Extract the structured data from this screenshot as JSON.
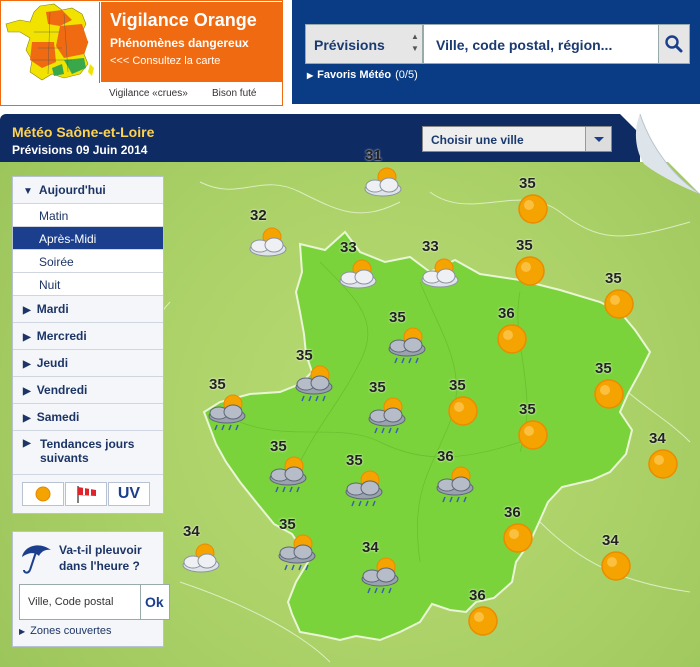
{
  "vigilance": {
    "title": "Vigilance Orange",
    "subtitle": "Phénomènes dangereux",
    "link": "<<< Consultez la carte",
    "crues": "Vigilance «crues»",
    "bison": "Bison futé"
  },
  "search": {
    "category": "Prévisions",
    "placeholder": "Ville, code postal, région...",
    "favorites_label": "Favoris Météo",
    "favorites_count": "(0/5)"
  },
  "header": {
    "title": "Météo Saône-et-Loire",
    "date": "Prévisions 09 Juin 2014",
    "city_select": "Choisir une ville"
  },
  "days": [
    {
      "label": "Aujourd'hui",
      "open": true
    },
    {
      "label": "Mardi"
    },
    {
      "label": "Mercredi"
    },
    {
      "label": "Jeudi"
    },
    {
      "label": "Vendredi"
    },
    {
      "label": "Samedi"
    },
    {
      "label": "Tendances jours suivants"
    }
  ],
  "periods": [
    "Matin",
    "Après-Midi",
    "Soirée",
    "Nuit"
  ],
  "selected_period": "Après-Midi",
  "map_buttons": {
    "uv": "UV"
  },
  "rain": {
    "question": "Va-t-il pleuvoir dans l'heure ?",
    "input_placeholder": "Ville, Code postal",
    "ok": "Ok",
    "zones": "Zones couvertes"
  },
  "colors": {
    "orange": "#f06a12",
    "navy": "#0f2b63",
    "blue": "#0a3c86",
    "map": "#7bd33b",
    "sun": "#f4a300"
  },
  "forecast": [
    {
      "temp": "31",
      "icon": "sun-cloud"
    },
    {
      "temp": "35",
      "icon": "sun"
    },
    {
      "temp": "32",
      "icon": "sun-cloud"
    },
    {
      "temp": "33",
      "icon": "sun-cloud"
    },
    {
      "temp": "33",
      "icon": "sun-cloud"
    },
    {
      "temp": "35",
      "icon": "sun"
    },
    {
      "temp": "35",
      "icon": "sun-rain"
    },
    {
      "temp": "36",
      "icon": "sun"
    },
    {
      "temp": "35",
      "icon": "sun-rain"
    },
    {
      "temp": "35",
      "icon": "sun"
    },
    {
      "temp": "35",
      "icon": "sun-rain"
    },
    {
      "temp": "35",
      "icon": "sun-rain"
    },
    {
      "temp": "35",
      "icon": "sun"
    },
    {
      "temp": "35",
      "icon": "sun"
    },
    {
      "temp": "35",
      "icon": "sun"
    },
    {
      "temp": "35",
      "icon": "sun-rain"
    },
    {
      "temp": "35",
      "icon": "sun-rain"
    },
    {
      "temp": "36",
      "icon": "sun-rain"
    },
    {
      "temp": "34",
      "icon": "sun"
    },
    {
      "temp": "36",
      "icon": "sun"
    },
    {
      "temp": "35",
      "icon": "sun-rain"
    },
    {
      "temp": "34",
      "icon": "sun-cloud"
    },
    {
      "temp": "34",
      "icon": "sun-rain"
    },
    {
      "temp": "34",
      "icon": "sun"
    },
    {
      "temp": "36",
      "icon": "sun"
    }
  ]
}
